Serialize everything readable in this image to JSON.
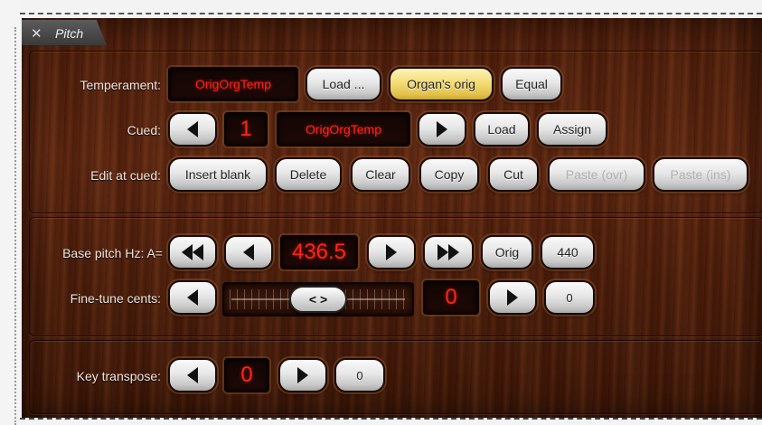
{
  "window": {
    "tab_title": "Pitch",
    "close_glyph": "✕"
  },
  "temperament": {
    "label": "Temperament:",
    "display_value": "OrigOrgTemp",
    "load_button": "Load ...",
    "organs_orig_button": "Organ's orig",
    "equal_button": "Equal"
  },
  "cued": {
    "label": "Cued:",
    "number": "1",
    "name": "OrigOrgTemp",
    "load_button": "Load",
    "assign_button": "Assign",
    "prev_icon": "triangle-left-icon",
    "next_icon": "triangle-right-icon"
  },
  "edit_at_cued": {
    "label": "Edit at cued:",
    "insert_blank_button": "Insert blank",
    "delete_button": "Delete",
    "clear_button": "Clear",
    "copy_button": "Copy",
    "cut_button": "Cut",
    "paste_ovr_button": "Paste (ovr)",
    "paste_ins_button": "Paste (ins)"
  },
  "base_pitch": {
    "label": "Base pitch Hz: A=",
    "value": "436.5",
    "orig_button": "Orig",
    "a440_button": "440"
  },
  "fine_tune": {
    "label": "Fine-tune cents:",
    "value": "0",
    "reset_button": "0",
    "knob_glyph": "< >"
  },
  "key_transpose": {
    "label": "Key transpose:",
    "value": "0",
    "reset_button": "0"
  },
  "colors": {
    "display_text": "#ff2414",
    "highlight_button": "#f4dc76",
    "wood_dark": "#3a1608",
    "wood_mid": "#5b2611"
  }
}
